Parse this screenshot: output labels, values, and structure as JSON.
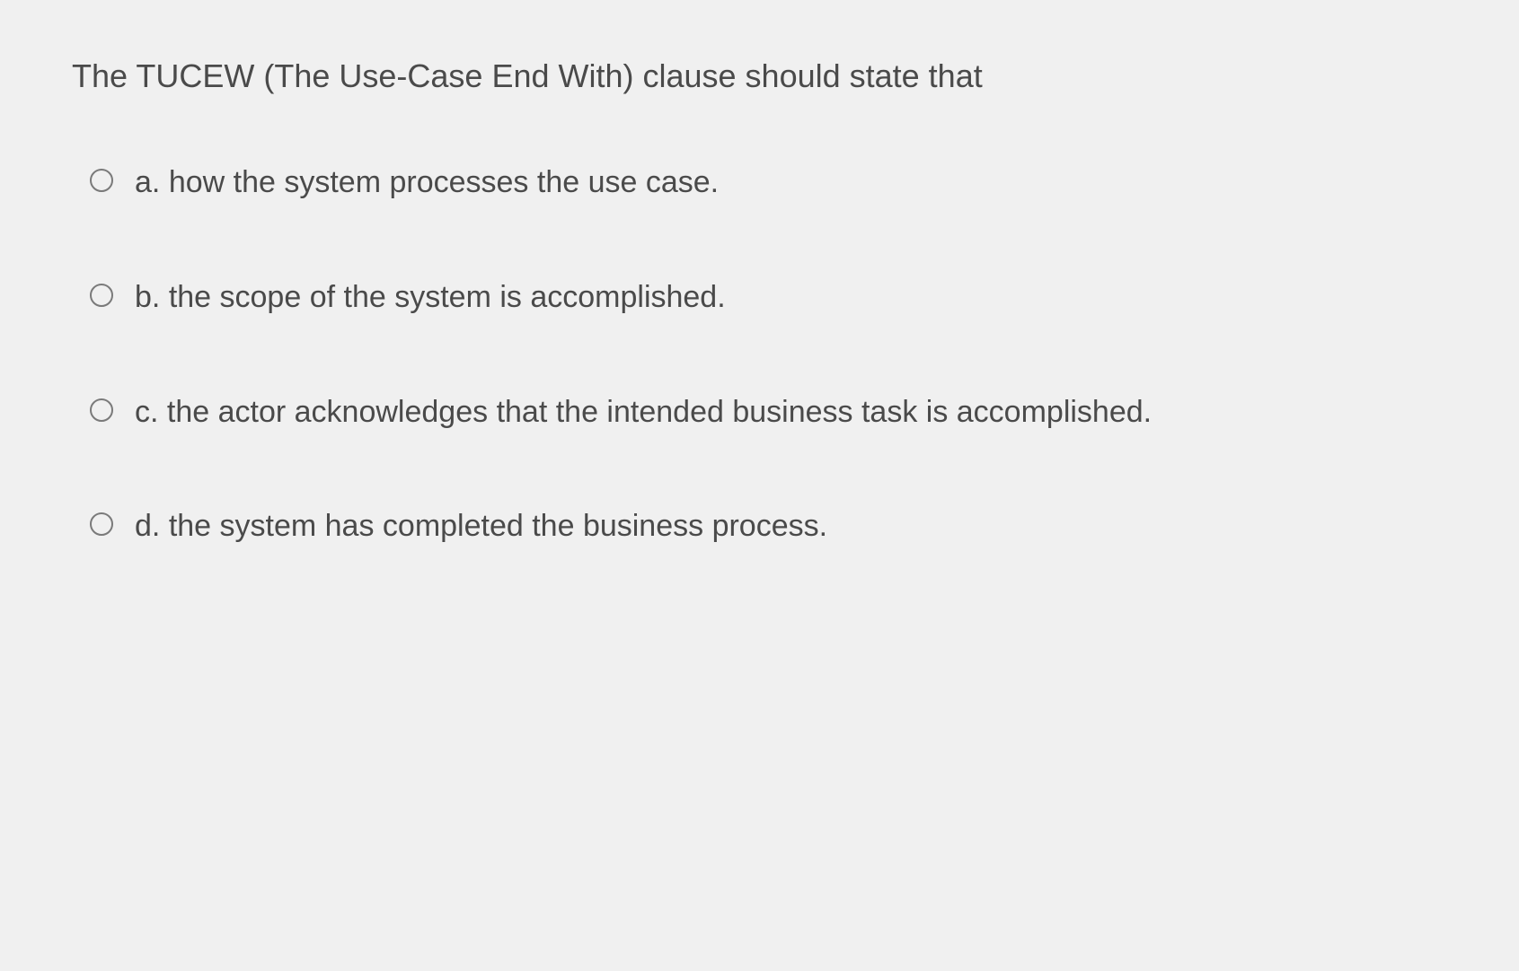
{
  "question": {
    "text": "The TUCEW (The Use-Case End With) clause should state that",
    "options": [
      {
        "label": "a.",
        "text": "how the system processes the use case."
      },
      {
        "label": "b.",
        "text": "the scope of the system is accomplished."
      },
      {
        "label": "c.",
        "text": "the actor acknowledges that the intended business task is accomplished."
      },
      {
        "label": "d.",
        "text": "the system has completed the business process."
      }
    ]
  }
}
